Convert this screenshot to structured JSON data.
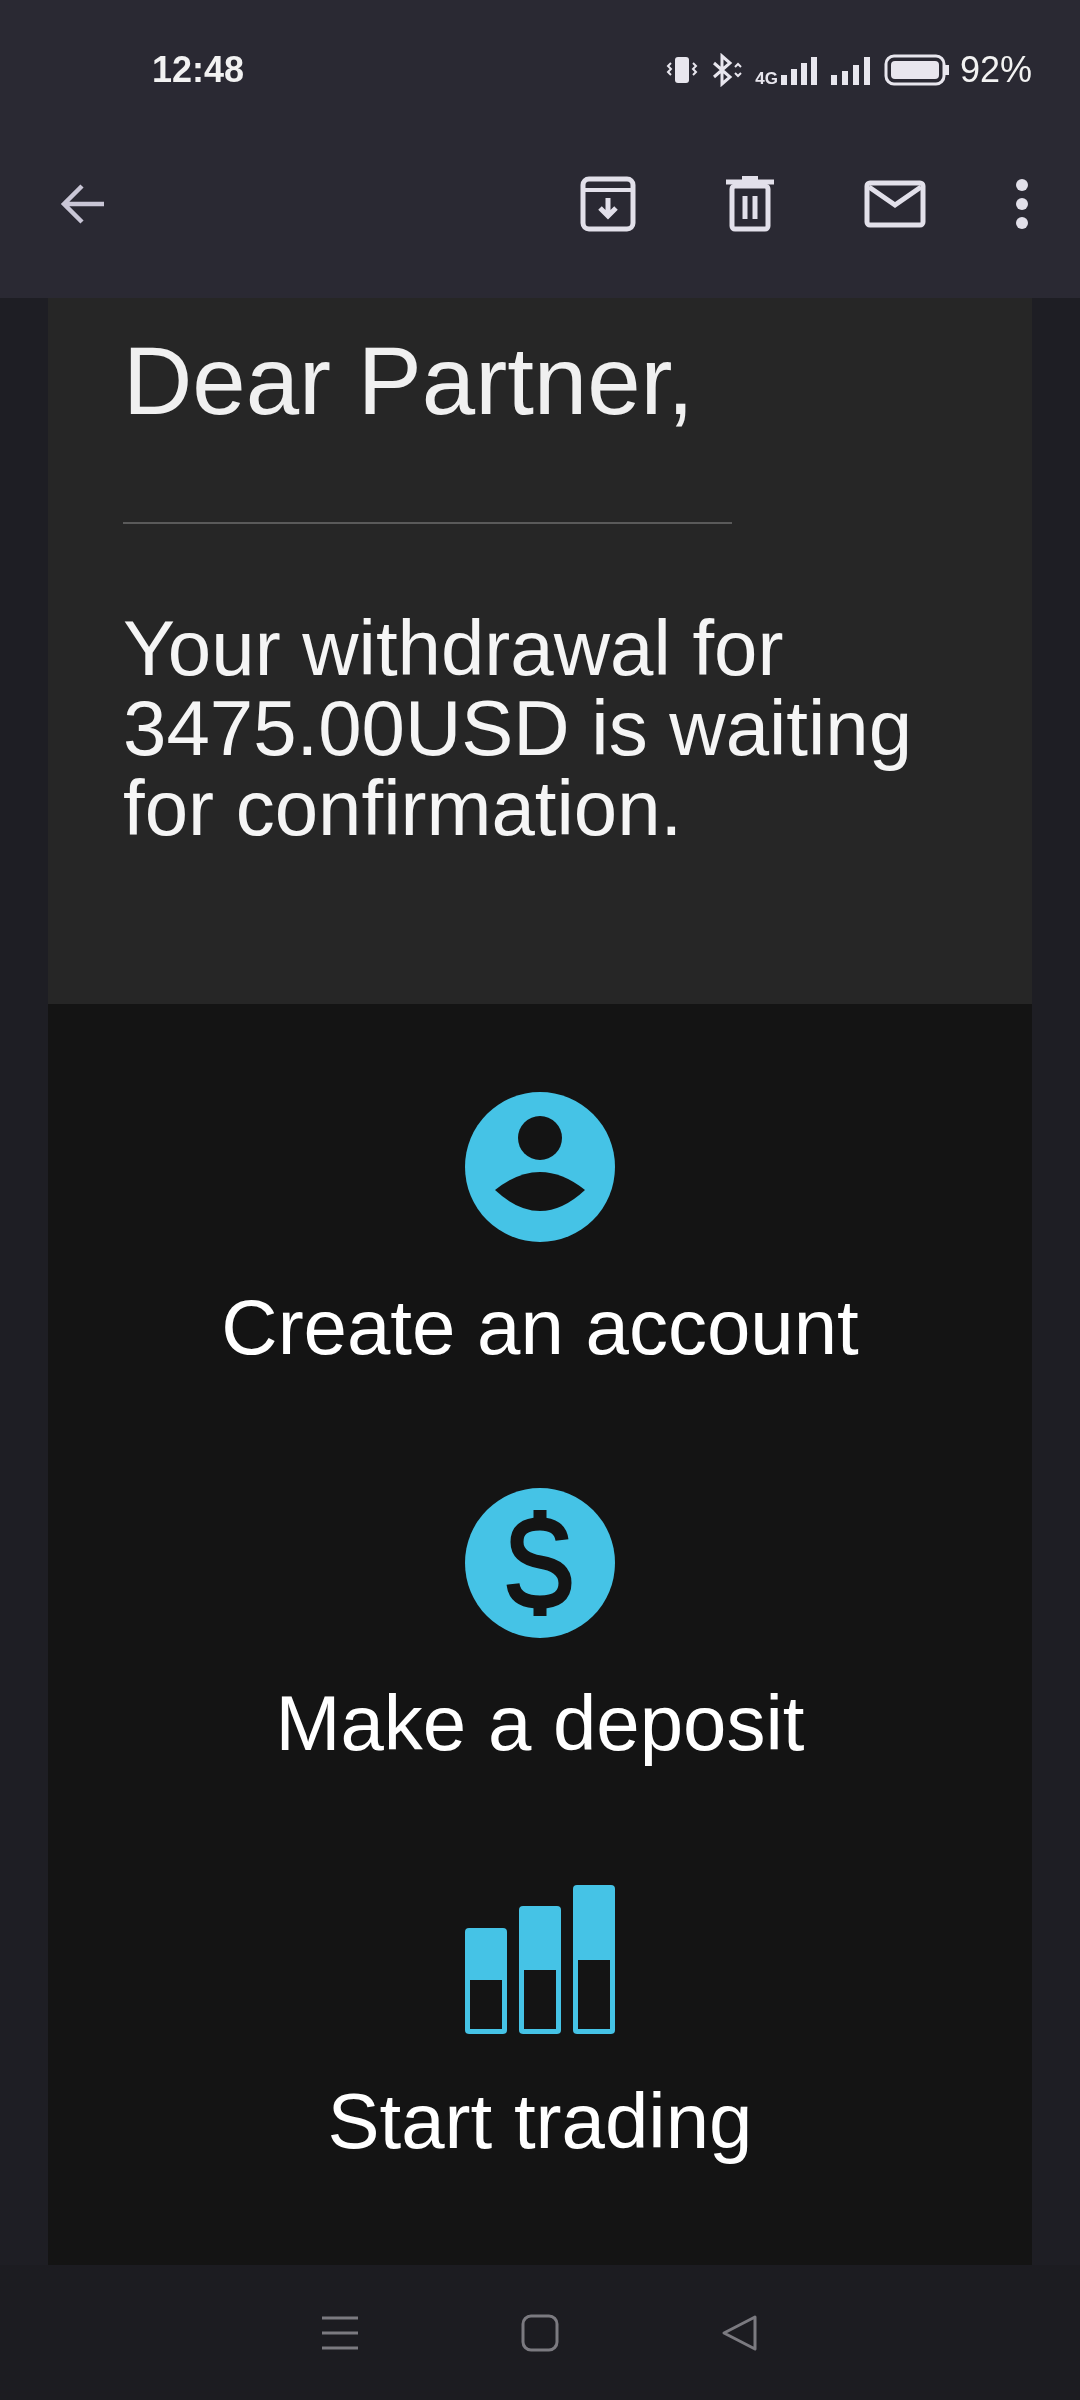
{
  "status_bar": {
    "time": "12:48",
    "network": "4G",
    "battery": "92%"
  },
  "email": {
    "greeting": "Dear Partner,",
    "message": "Your withdrawal for 3475.00USD is waiting for confirmation.",
    "actions": [
      {
        "kind": "account",
        "label": "Create an account"
      },
      {
        "kind": "deposit",
        "label": "Make a deposit"
      },
      {
        "kind": "trading",
        "label": "Start trading"
      }
    ]
  }
}
